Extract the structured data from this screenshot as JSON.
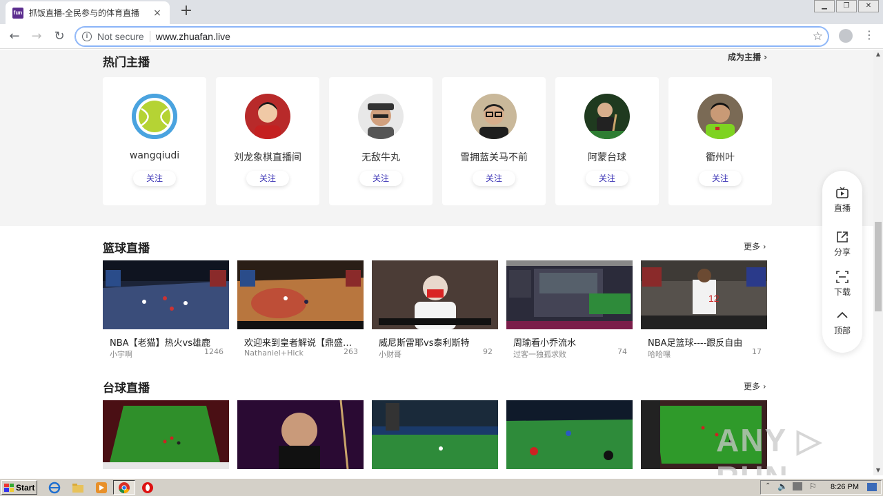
{
  "browser": {
    "tab_title": "抓饭直播-全民参与的体育直播",
    "favicon_text": "fun",
    "close_tab": "×",
    "new_tab": "+",
    "security_label": "Not secure",
    "url": "www.zhuafan.live",
    "back": "←",
    "forward": "→",
    "reload": "↻",
    "star": "☆",
    "menu": "⋮"
  },
  "hot_anchors": {
    "title": "热门主播",
    "more_label": "成为主播 ›",
    "follow_label": "关注",
    "items": [
      {
        "name": "wangqiudi",
        "avatar_icon": "tennis-ball-icon"
      },
      {
        "name": "刘龙象棋直播间",
        "avatar_icon": "person-photo"
      },
      {
        "name": "无敌牛丸",
        "avatar_icon": "person-photo"
      },
      {
        "name": "雪拥蓝关马不前",
        "avatar_icon": "person-photo"
      },
      {
        "name": "阿蒙台球",
        "avatar_icon": "snooker-photo"
      },
      {
        "name": "衢州叶",
        "avatar_icon": "person-photo"
      }
    ]
  },
  "basketball": {
    "title": "篮球直播",
    "more_label": "更多 ›",
    "items": [
      {
        "title": "NBA【老猫】热火vs雄鹿",
        "author": "小宇啊",
        "count": "1246"
      },
      {
        "title": "欢迎来到皇者解说【鼎盛…",
        "author": "Nathaniel+Hick",
        "count": "263"
      },
      {
        "title": "威尼斯雷耶vs泰利斯特",
        "author": "小财哥",
        "count": "92"
      },
      {
        "title": "周瑜看小乔流水",
        "author": "过客一独孤求败",
        "count": "74"
      },
      {
        "title": "NBA足篮球----跟反自由",
        "author": "哈哈嘿",
        "count": "17"
      }
    ]
  },
  "billiards": {
    "title": "台球直播",
    "more_label": "更多 ›"
  },
  "side_panel": {
    "live": "直播",
    "share": "分享",
    "download": "下载",
    "top": "顶部"
  },
  "watermark": "ANY ▷ RUN",
  "taskbar": {
    "start": "Start",
    "clock": "8:26 PM"
  },
  "colors": {
    "accent": "#3a32b5",
    "page_band": "#f4f4f4"
  }
}
